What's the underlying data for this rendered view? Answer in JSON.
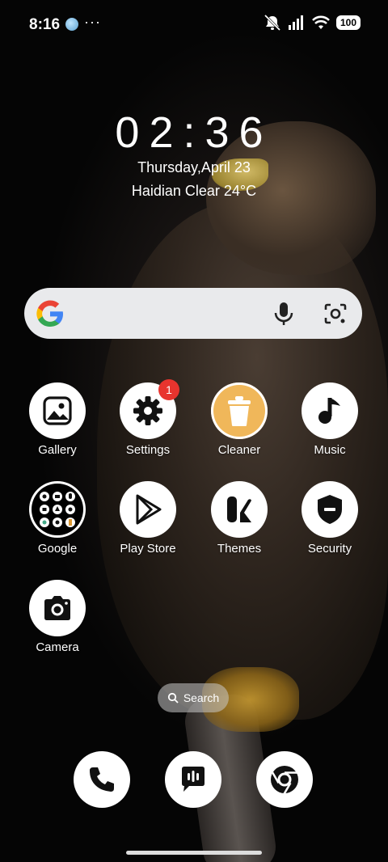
{
  "status_bar": {
    "time": "8:16",
    "more": "···",
    "battery": "100"
  },
  "clock": {
    "time": "02:36",
    "date": "Thursday,April 23",
    "weather": "Haidian Clear 24°C"
  },
  "apps": [
    {
      "label": "Gallery"
    },
    {
      "label": "Settings",
      "badge": "1"
    },
    {
      "label": "Cleaner"
    },
    {
      "label": "Music"
    },
    {
      "label": "Google"
    },
    {
      "label": "Play Store"
    },
    {
      "label": "Themes"
    },
    {
      "label": "Security"
    },
    {
      "label": "Camera"
    }
  ],
  "home_search": {
    "label": "Search"
  },
  "dock": [
    {
      "icon": "phone-icon"
    },
    {
      "icon": "messages-icon"
    },
    {
      "icon": "chrome-icon"
    }
  ],
  "colors": {
    "badge": "#e8342e",
    "cleaner": "#f0b75a",
    "search_bar": "#e9eaec"
  }
}
